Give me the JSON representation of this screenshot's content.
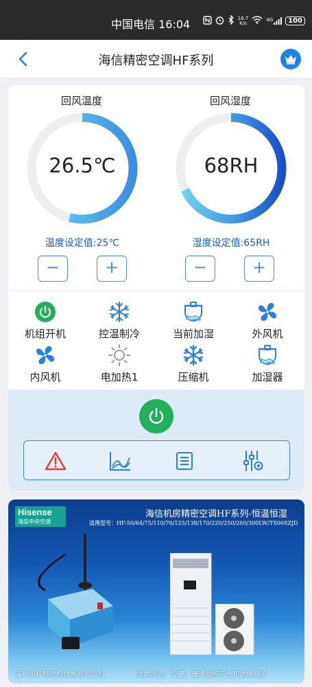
{
  "status_bar": {
    "carrier_time": "中国电信 16:04",
    "net_speed_top": "18.7",
    "net_speed_bottom": "K/s",
    "network": "4G",
    "battery": "100"
  },
  "header": {
    "title": "海信精密空调HF系列",
    "back_icon": "chevron-left-icon",
    "vip_icon": "crown-icon"
  },
  "gauges": [
    {
      "label": "回风温度",
      "value": "26.5℃",
      "fill_fraction": 0.54,
      "setpoint": "温度设定值:25℃",
      "minus": "−",
      "plus": "+"
    },
    {
      "label": "回风湿度",
      "value": "68RH",
      "fill_fraction": 0.68,
      "setpoint": "湿度设定值:65RH",
      "minus": "−",
      "plus": "+"
    }
  ],
  "status_items": [
    {
      "label": "机组开机",
      "icon": "power-on-icon"
    },
    {
      "label": "控温制冷",
      "icon": "snowflake-icon"
    },
    {
      "label": "当前加湿",
      "icon": "humidifier-icon"
    },
    {
      "label": "外风机",
      "icon": "fan-icon"
    },
    {
      "label": "内风机",
      "icon": "fan-icon"
    },
    {
      "label": "电加热1",
      "icon": "heater-icon"
    },
    {
      "label": "压缩机",
      "icon": "snowflake-icon"
    },
    {
      "label": "加湿器",
      "icon": "humidifier-icon"
    }
  ],
  "toolbar_icons": [
    "alarm-icon",
    "trend-chart-icon",
    "list-icon",
    "settings-slider-icon"
  ],
  "banner": {
    "logo": "Hisense",
    "logo_sub": "海信中央空调",
    "title": "海信机房精密空调HF系列-恒温恒湿",
    "models": "适用型号：HF-50/64/75/110/76/125/138/170/220/250/260/300LW/TS06SZJD",
    "footer_left": "深圳市科特时控技术有限公司",
    "footer_right": "提供冷冻、冷藏、暖通监控平台和边缘网关"
  },
  "colors": {
    "accent": "#1e84e6",
    "power_green": "#22b15a",
    "alarm_red": "#e53935",
    "gauge_track": "#eeeeee"
  }
}
